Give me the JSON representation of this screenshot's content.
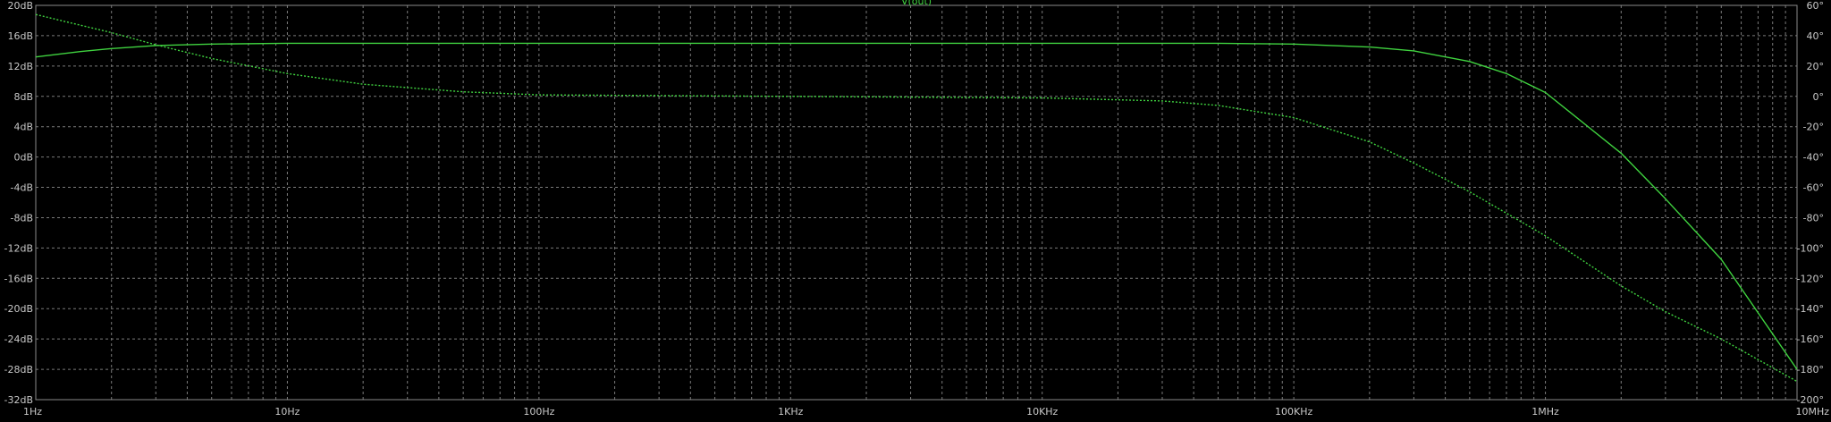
{
  "chart_data": {
    "type": "line",
    "title": "V(out)",
    "x_scale": "log",
    "xlim": [
      1,
      10000000
    ],
    "ylim_left": [
      -32,
      20
    ],
    "ylim_right": [
      -200,
      60
    ],
    "grid": true,
    "x_tick_labels": [
      {
        "value": 1,
        "label": "1Hz"
      },
      {
        "value": 10,
        "label": "10Hz"
      },
      {
        "value": 100,
        "label": "100Hz"
      },
      {
        "value": 1000,
        "label": "1KHz"
      },
      {
        "value": 10000,
        "label": "10KHz"
      },
      {
        "value": 100000,
        "label": "100KHz"
      },
      {
        "value": 1000000,
        "label": "1MHz"
      },
      {
        "value": 10000000,
        "label": "10MHz"
      }
    ],
    "y_left_ticks": [
      {
        "value": 20,
        "label": "20dB"
      },
      {
        "value": 16,
        "label": "16dB"
      },
      {
        "value": 12,
        "label": "12dB"
      },
      {
        "value": 8,
        "label": "8dB"
      },
      {
        "value": 4,
        "label": "4dB"
      },
      {
        "value": 0,
        "label": "0dB"
      },
      {
        "value": -4,
        "label": "-4dB"
      },
      {
        "value": -8,
        "label": "-8dB"
      },
      {
        "value": -12,
        "label": "-12dB"
      },
      {
        "value": -16,
        "label": "-16dB"
      },
      {
        "value": -20,
        "label": "-20dB"
      },
      {
        "value": -24,
        "label": "-24dB"
      },
      {
        "value": -28,
        "label": "-28dB"
      },
      {
        "value": -32,
        "label": "-32dB"
      }
    ],
    "y_right_ticks": [
      {
        "value": 60,
        "label": "60°"
      },
      {
        "value": 40,
        "label": "40°"
      },
      {
        "value": 20,
        "label": "20°"
      },
      {
        "value": 0,
        "label": "0°"
      },
      {
        "value": -20,
        "label": "-20°"
      },
      {
        "value": -40,
        "label": "-40°"
      },
      {
        "value": -60,
        "label": "-60°"
      },
      {
        "value": -80,
        "label": "-80°"
      },
      {
        "value": -100,
        "label": "-100°"
      },
      {
        "value": -120,
        "label": "-120°"
      },
      {
        "value": -140,
        "label": "-140°"
      },
      {
        "value": -160,
        "label": "-160°"
      },
      {
        "value": -180,
        "label": "-180°"
      },
      {
        "value": -200,
        "label": "-200°"
      }
    ],
    "series": [
      {
        "name": "V(out)",
        "kind": "magnitude",
        "axis": "left",
        "color": "#3fd23f",
        "dashed": false,
        "x": [
          1,
          1.5,
          2,
          3,
          5,
          10,
          100,
          1000,
          10000,
          50000,
          100000,
          200000,
          300000,
          500000,
          700000,
          1000000,
          2000000,
          3000000,
          5000000,
          10000000
        ],
        "y": [
          13.2,
          13.9,
          14.3,
          14.7,
          14.9,
          15.0,
          15.0,
          15.0,
          15.0,
          15.0,
          14.9,
          14.5,
          14.0,
          12.6,
          11.0,
          8.5,
          0.5,
          -5.5,
          -13.5,
          -28.0
        ]
      },
      {
        "name": "V(out)",
        "kind": "phase",
        "axis": "right",
        "color": "#3fd23f",
        "dashed": true,
        "x": [
          1,
          1.5,
          2,
          3,
          5,
          10,
          20,
          50,
          100,
          1000,
          10000,
          30000,
          50000,
          100000,
          200000,
          300000,
          500000,
          1000000,
          2000000,
          3000000,
          5000000,
          10000000
        ],
        "y": [
          54,
          47,
          42,
          34,
          25,
          15,
          8,
          3,
          1,
          0,
          -1,
          -3,
          -6,
          -14,
          -30,
          -44,
          -63,
          -92,
          -125,
          -142,
          -160,
          -188
        ]
      }
    ]
  }
}
